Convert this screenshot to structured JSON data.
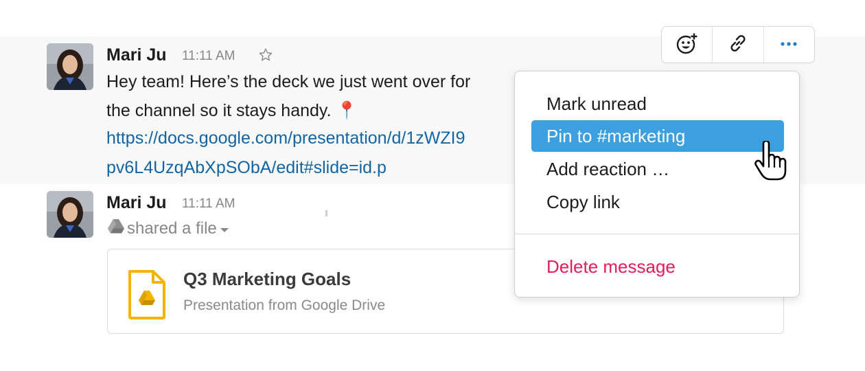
{
  "messages": [
    {
      "author": "Mari Ju",
      "time": "11:11 AM",
      "body_line1": "Hey team! Here’s the deck we just went over for",
      "body_line2": "the channel so it stays handy.",
      "emoji": "📍",
      "link_line1": "https://docs.google.com/presentation/d/1zWZI9",
      "link_line2": "pv6L4UzqAbXpSObA/edit#slide=id.p"
    },
    {
      "author": "Mari Ju",
      "time": "11:11 AM",
      "shared_text": "shared a file",
      "file": {
        "title": "Q3 Marketing Goals",
        "subtitle": "Presentation from Google Drive"
      }
    }
  ],
  "toolbar": {
    "buttons": [
      "add-reaction-icon",
      "copy-link-icon",
      "more-actions-icon"
    ]
  },
  "menu": {
    "items": [
      {
        "label": "Mark unread"
      },
      {
        "label": "Pin to #marketing",
        "highlighted": true
      },
      {
        "label": "Add reaction …"
      },
      {
        "label": "Copy link"
      },
      {
        "label": "Delete message",
        "danger": true
      }
    ]
  },
  "colors": {
    "link": "#1264a3",
    "highlight": "#3b9fe0",
    "danger": "#e01e5a",
    "hover_band": "#f8f8f8",
    "drive_yellow": "#f4b400"
  }
}
